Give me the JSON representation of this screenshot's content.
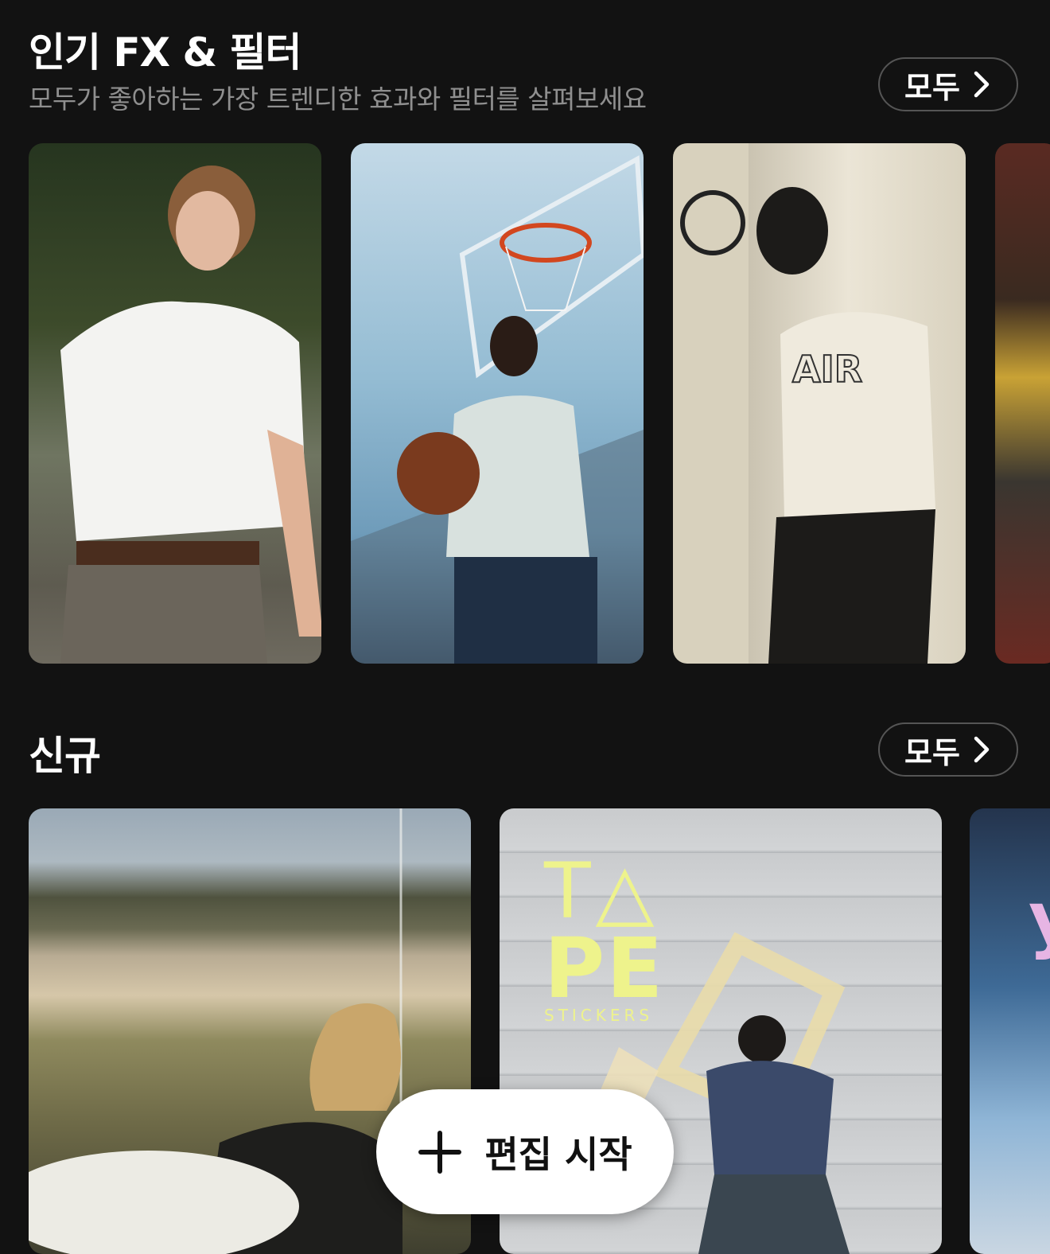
{
  "popular": {
    "title": "인기 FX & 필터",
    "subtitle": "모두가 좋아하는 가장 트렌디한 효과와 필터를 살펴보세요",
    "all_label": "모두",
    "cards": [
      "white-tshirt-portrait",
      "basketball-court-portrait",
      "air-tee-wall-portrait",
      "yellow-jacket-partial"
    ]
  },
  "new": {
    "title": "신규",
    "all_label": "모두",
    "cards": [
      {
        "id": "beach-surfer"
      },
      {
        "id": "tape-stickers",
        "text_top": "T△",
        "text_mid": "PE",
        "text_bottom": "STICKERS"
      },
      {
        "id": "blue-sky-partial"
      }
    ]
  },
  "fab": {
    "label": "편집 시작"
  }
}
